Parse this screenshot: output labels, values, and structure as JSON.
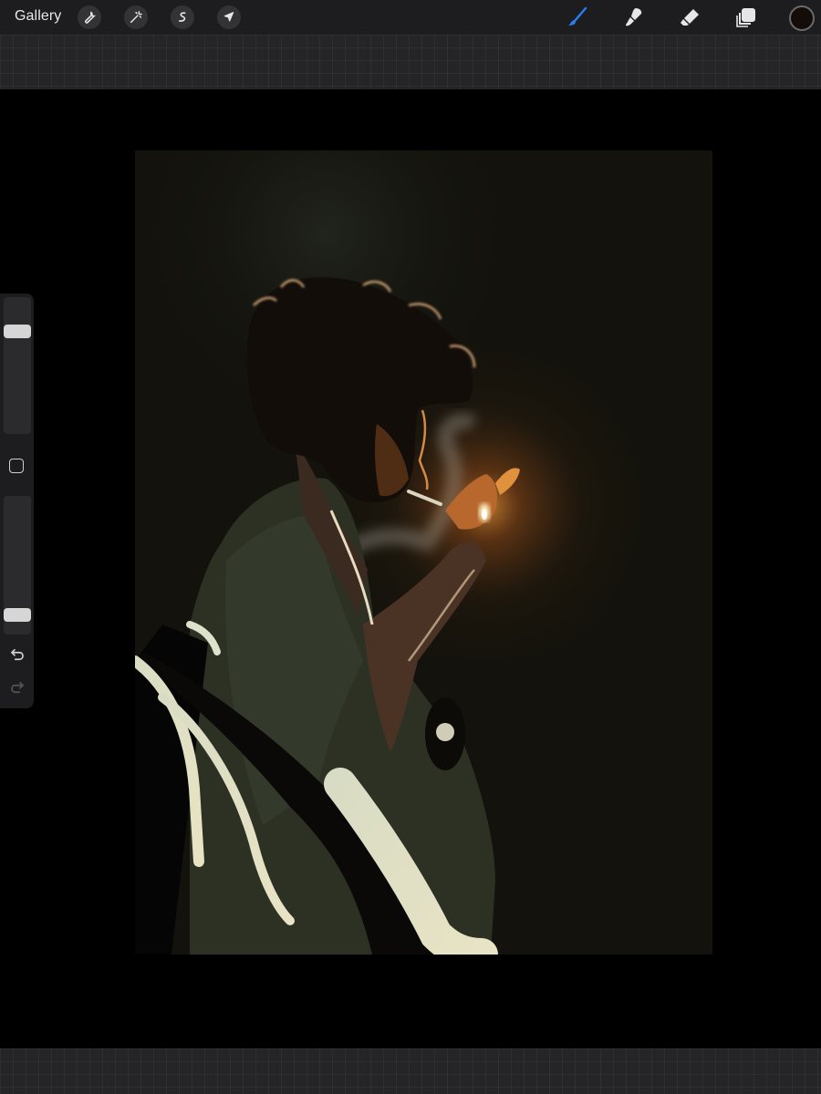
{
  "toolbar": {
    "gallery_label": "Gallery",
    "left_tools": [
      {
        "icon": "wrench-icon",
        "name": "actions"
      },
      {
        "icon": "magic-wand-icon",
        "name": "adjustments"
      },
      {
        "icon": "selection-icon",
        "name": "selection"
      },
      {
        "icon": "arrow-cursor-icon",
        "name": "transform"
      }
    ],
    "right_tools": [
      {
        "icon": "brush-icon",
        "name": "paint",
        "active": true
      },
      {
        "icon": "smudge-icon",
        "name": "smudge",
        "active": false
      },
      {
        "icon": "eraser-icon",
        "name": "eraser",
        "active": false
      },
      {
        "icon": "layers-icon",
        "name": "layers",
        "active": false
      }
    ],
    "active_color": "#140c08",
    "accent_color": "#2a7df7"
  },
  "sidebar": {
    "brush_size_level": 0.78,
    "brush_opacity_level": 0.1
  }
}
